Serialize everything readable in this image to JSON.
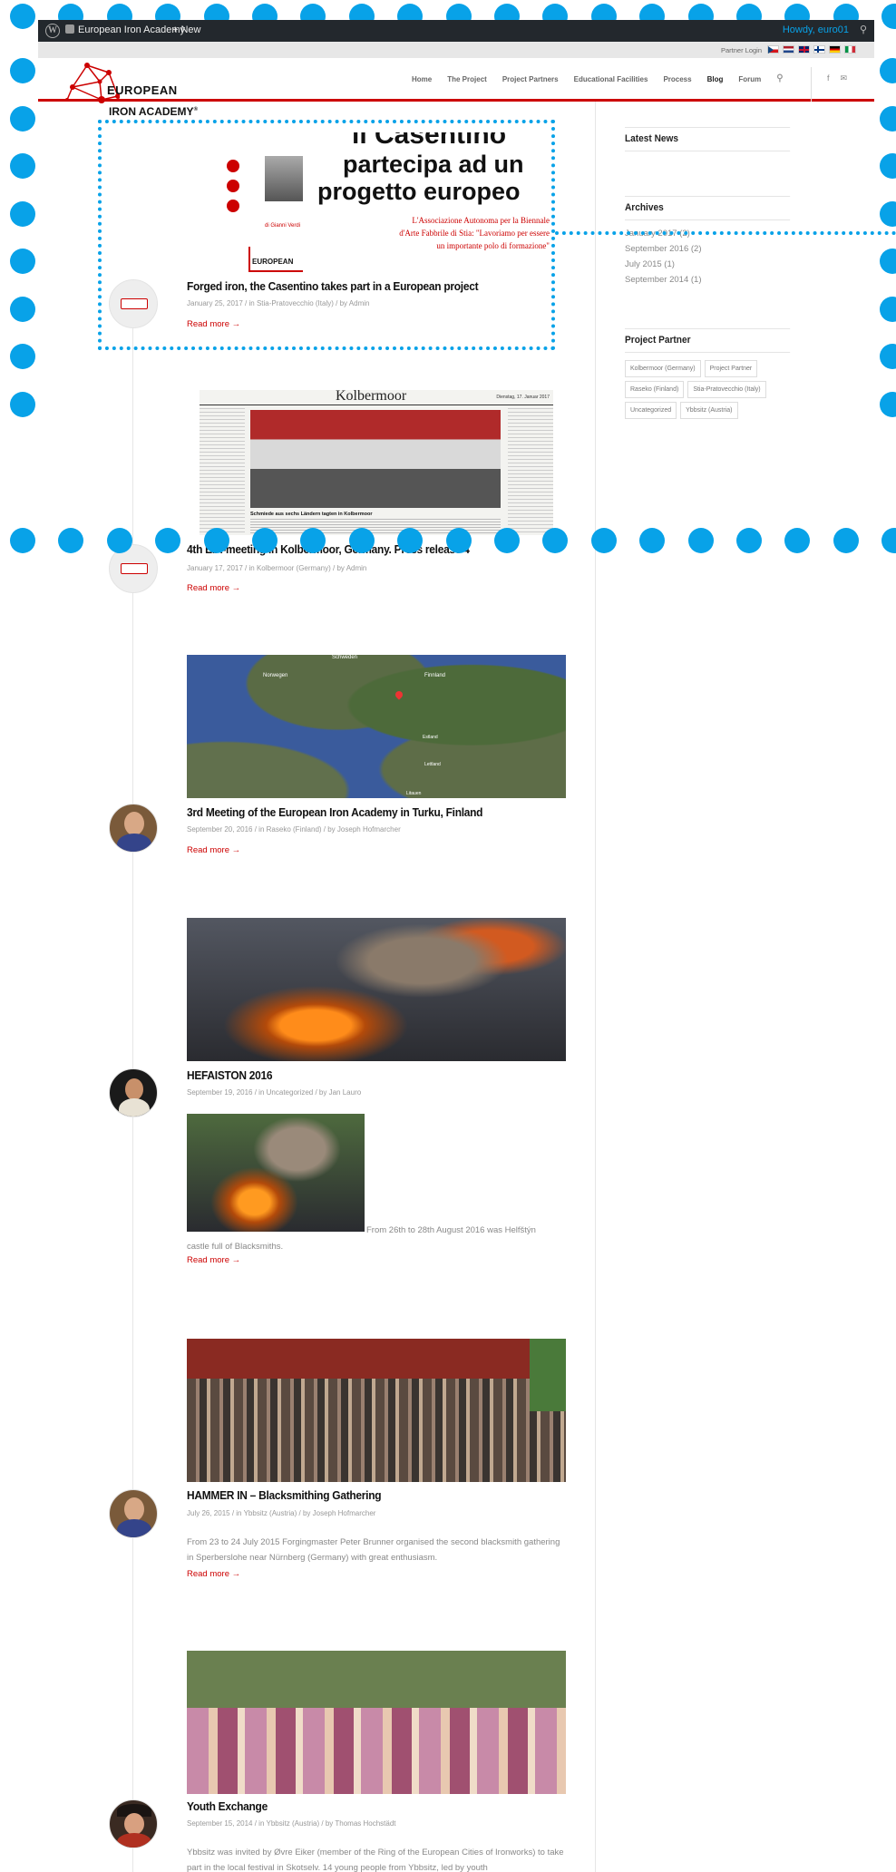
{
  "adminbar": {
    "site_name": "European Iron Academy",
    "new_label": "New",
    "howdy": "Howdy, euro01"
  },
  "topbar": {
    "partner_login": "Partner Login",
    "flags": [
      "cz",
      "nl",
      "gb",
      "fi",
      "de",
      "it"
    ]
  },
  "logo": {
    "line1": "EUROPEAN",
    "line2": "IRON ACADEMY",
    "reg": "®"
  },
  "nav": [
    "Home",
    "The Project",
    "Project Partners",
    "Educational Facilities",
    "Process",
    "Blog",
    "Forum"
  ],
  "nav_active": "Blog",
  "social": [
    "f",
    "✉"
  ],
  "posts": [
    {
      "title": "Forged iron, the Casentino takes part in a European project",
      "date": "January 25, 2017",
      "category": "Stia-Pratovecchio (Italy)",
      "author": "Admin",
      "more": "Read more →",
      "image_text": {
        "h1": "il Casentino",
        "h2": "partecipa ad un",
        "h3": "progetto europeo",
        "by": "di Gianni Verdi",
        "sub1": "L'Associazione Autonoma per la Biennale",
        "sub2": "d'Arte Fabbrile di Stia: \"Lavoriamo per essere",
        "sub3": "un importante polo di formazione\"",
        "logo": "EUROPEAN"
      }
    },
    {
      "title": "4th EIA-meeting in Kolbermoor, Germany. Press release 4",
      "date": "January 17, 2017",
      "category": "Kolbermoor (Germany)",
      "author": "Admin",
      "more": "Read more →",
      "image_text": {
        "masthead": "Kolbermoor",
        "date": "Dienstag, 17. Januar 2017",
        "caption": "Schmiede aus sechs Ländern tagten in Kolbermoor"
      }
    },
    {
      "title": "3rd Meeting of the European Iron Academy in Turku, Finland",
      "date": "September 20, 2016",
      "category": "Raseko (Finland)",
      "author": "Joseph Hofmarcher",
      "more": "Read more →",
      "image_text": {
        "l1": "Schweden",
        "l2": "Norwegen",
        "l3": "Finnland",
        "l4": "Estland",
        "l5": "Lettland",
        "l6": "Litauen"
      }
    },
    {
      "title": "HEFAISTON 2016",
      "date": "September 19, 2016",
      "category": "Uncategorized",
      "author": "Jan Lauro",
      "excerpt1": "From 26th to 28th August 2016 was Helfštýn",
      "excerpt2": "castle full of Blacksmiths.",
      "more": "Read more →"
    },
    {
      "title": "HAMMER IN – Blacksmithing Gathering",
      "date": "July 26, 2015",
      "category": "Ybbsitz (Austria)",
      "author": "Joseph Hofmarcher",
      "excerpt": "From 23 to 24 July 2015 Forgingmaster Peter Brunner organised the second blacksmith gathering in Sperberslohe near Nürnberg (Germany) with great enthusiasm.",
      "more": "Read more →"
    },
    {
      "title": "Youth Exchange",
      "date": "September 15, 2014",
      "category": "Ybbsitz (Austria)",
      "author": "Thomas Hochstädt",
      "excerpt": "Ybbsitz was invited by Øvre Eiker (member of the Ring of the European Cities of Ironworks) to take part in the local festival in Skotselv. 14 young people from Ybbsitz, led by youth"
    }
  ],
  "meta_labels": {
    "in": "in",
    "by": "by"
  },
  "sidebar": {
    "latest_title": "Latest News",
    "archives_title": "Archives",
    "archives": [
      "January 2017 (2)",
      "September 2016 (2)",
      "July 2015 (1)",
      "September 2014 (1)"
    ],
    "partner_title": "Project Partner",
    "tags": [
      "Kolbermoor (Germany)",
      "Project Partner",
      "Raseko (Finland)",
      "Stia-Pratovecchio (Italy)",
      "Uncategorized",
      "Ybbsitz (Austria)"
    ]
  },
  "colors": {
    "accent": "#cc0000",
    "overlay": "#08a2e8",
    "adminbar": "#23282d"
  }
}
